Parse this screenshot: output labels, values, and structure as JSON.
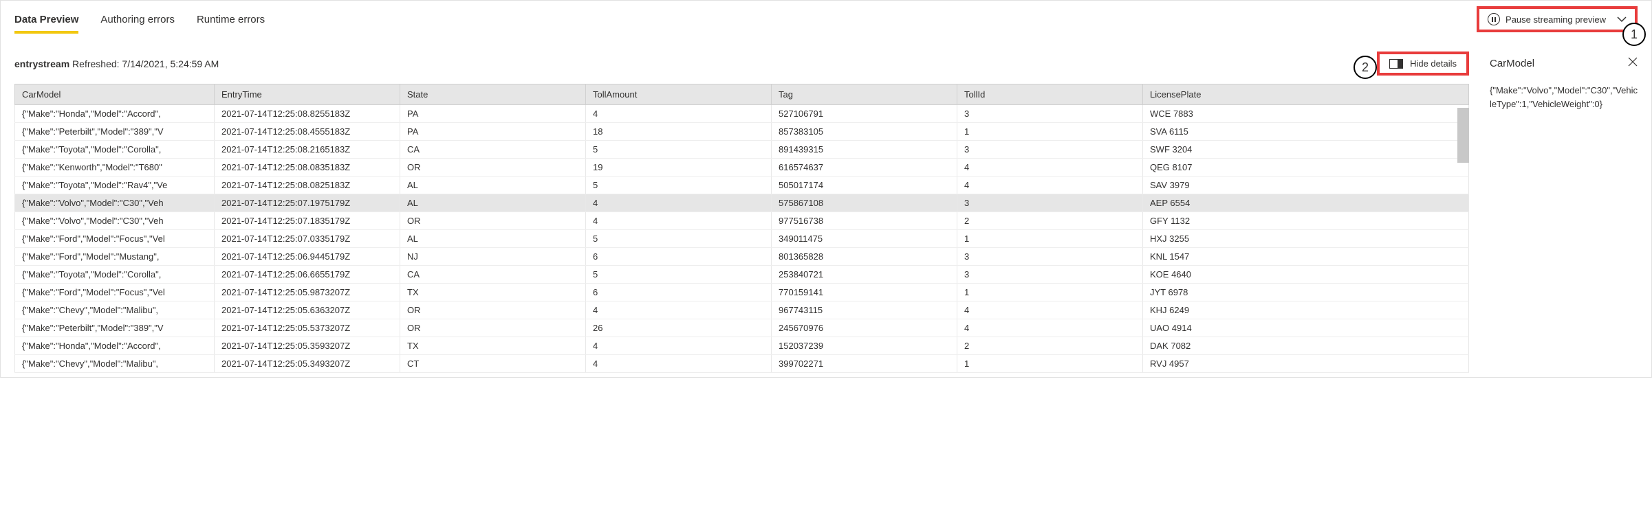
{
  "tabs": {
    "data_preview": "Data Preview",
    "authoring_errors": "Authoring errors",
    "runtime_errors": "Runtime errors"
  },
  "pause_button": {
    "label": "Pause streaming preview"
  },
  "callouts": {
    "one": "1",
    "two": "2"
  },
  "stream": {
    "name": "entrystream",
    "refreshed_label": "Refreshed: 7/14/2021, 5:24:59 AM"
  },
  "hide_details": {
    "label": "Hide details"
  },
  "table": {
    "headers": {
      "carmodel": "CarModel",
      "entrytime": "EntryTime",
      "state": "State",
      "tollamount": "TollAmount",
      "tag": "Tag",
      "tollid": "TollId",
      "licenseplate": "LicensePlate"
    },
    "rows": [
      {
        "carmodel": "{\"Make\":\"Honda\",\"Model\":\"Accord\",",
        "entrytime": "2021-07-14T12:25:08.8255183Z",
        "state": "PA",
        "tollamount": "4",
        "tag": "527106791",
        "tollid": "3",
        "plate": "WCE 7883"
      },
      {
        "carmodel": "{\"Make\":\"Peterbilt\",\"Model\":\"389\",\"V",
        "entrytime": "2021-07-14T12:25:08.4555183Z",
        "state": "PA",
        "tollamount": "18",
        "tag": "857383105",
        "tollid": "1",
        "plate": "SVA 6115"
      },
      {
        "carmodel": "{\"Make\":\"Toyota\",\"Model\":\"Corolla\",",
        "entrytime": "2021-07-14T12:25:08.2165183Z",
        "state": "CA",
        "tollamount": "5",
        "tag": "891439315",
        "tollid": "3",
        "plate": "SWF 3204"
      },
      {
        "carmodel": "{\"Make\":\"Kenworth\",\"Model\":\"T680\"",
        "entrytime": "2021-07-14T12:25:08.0835183Z",
        "state": "OR",
        "tollamount": "19",
        "tag": "616574637",
        "tollid": "4",
        "plate": "QEG 8107"
      },
      {
        "carmodel": "{\"Make\":\"Toyota\",\"Model\":\"Rav4\",\"Ve",
        "entrytime": "2021-07-14T12:25:08.0825183Z",
        "state": "AL",
        "tollamount": "5",
        "tag": "505017174",
        "tollid": "4",
        "plate": "SAV 3979"
      },
      {
        "carmodel": "{\"Make\":\"Volvo\",\"Model\":\"C30\",\"Veh",
        "entrytime": "2021-07-14T12:25:07.1975179Z",
        "state": "AL",
        "tollamount": "4",
        "tag": "575867108",
        "tollid": "3",
        "plate": "AEP 6554",
        "selected": true
      },
      {
        "carmodel": "{\"Make\":\"Volvo\",\"Model\":\"C30\",\"Veh",
        "entrytime": "2021-07-14T12:25:07.1835179Z",
        "state": "OR",
        "tollamount": "4",
        "tag": "977516738",
        "tollid": "2",
        "plate": "GFY 1132"
      },
      {
        "carmodel": "{\"Make\":\"Ford\",\"Model\":\"Focus\",\"Vel",
        "entrytime": "2021-07-14T12:25:07.0335179Z",
        "state": "AL",
        "tollamount": "5",
        "tag": "349011475",
        "tollid": "1",
        "plate": "HXJ 3255"
      },
      {
        "carmodel": "{\"Make\":\"Ford\",\"Model\":\"Mustang\",",
        "entrytime": "2021-07-14T12:25:06.9445179Z",
        "state": "NJ",
        "tollamount": "6",
        "tag": "801365828",
        "tollid": "3",
        "plate": "KNL 1547"
      },
      {
        "carmodel": "{\"Make\":\"Toyota\",\"Model\":\"Corolla\",",
        "entrytime": "2021-07-14T12:25:06.6655179Z",
        "state": "CA",
        "tollamount": "5",
        "tag": "253840721",
        "tollid": "3",
        "plate": "KOE 4640"
      },
      {
        "carmodel": "{\"Make\":\"Ford\",\"Model\":\"Focus\",\"Vel",
        "entrytime": "2021-07-14T12:25:05.9873207Z",
        "state": "TX",
        "tollamount": "6",
        "tag": "770159141",
        "tollid": "1",
        "plate": "JYT 6978"
      },
      {
        "carmodel": "{\"Make\":\"Chevy\",\"Model\":\"Malibu\",",
        "entrytime": "2021-07-14T12:25:05.6363207Z",
        "state": "OR",
        "tollamount": "4",
        "tag": "967743115",
        "tollid": "4",
        "plate": "KHJ 6249"
      },
      {
        "carmodel": "{\"Make\":\"Peterbilt\",\"Model\":\"389\",\"V",
        "entrytime": "2021-07-14T12:25:05.5373207Z",
        "state": "OR",
        "tollamount": "26",
        "tag": "245670976",
        "tollid": "4",
        "plate": "UAO 4914"
      },
      {
        "carmodel": "{\"Make\":\"Honda\",\"Model\":\"Accord\",",
        "entrytime": "2021-07-14T12:25:05.3593207Z",
        "state": "TX",
        "tollamount": "4",
        "tag": "152037239",
        "tollid": "2",
        "plate": "DAK 7082"
      },
      {
        "carmodel": "{\"Make\":\"Chevy\",\"Model\":\"Malibu\",",
        "entrytime": "2021-07-14T12:25:05.3493207Z",
        "state": "CT",
        "tollamount": "4",
        "tag": "399702271",
        "tollid": "1",
        "plate": "RVJ 4957"
      }
    ]
  },
  "detail_panel": {
    "title": "CarModel",
    "content": "{\"Make\":\"Volvo\",\"Model\":\"C30\",\"VehicleType\":1,\"VehicleWeight\":0}"
  }
}
